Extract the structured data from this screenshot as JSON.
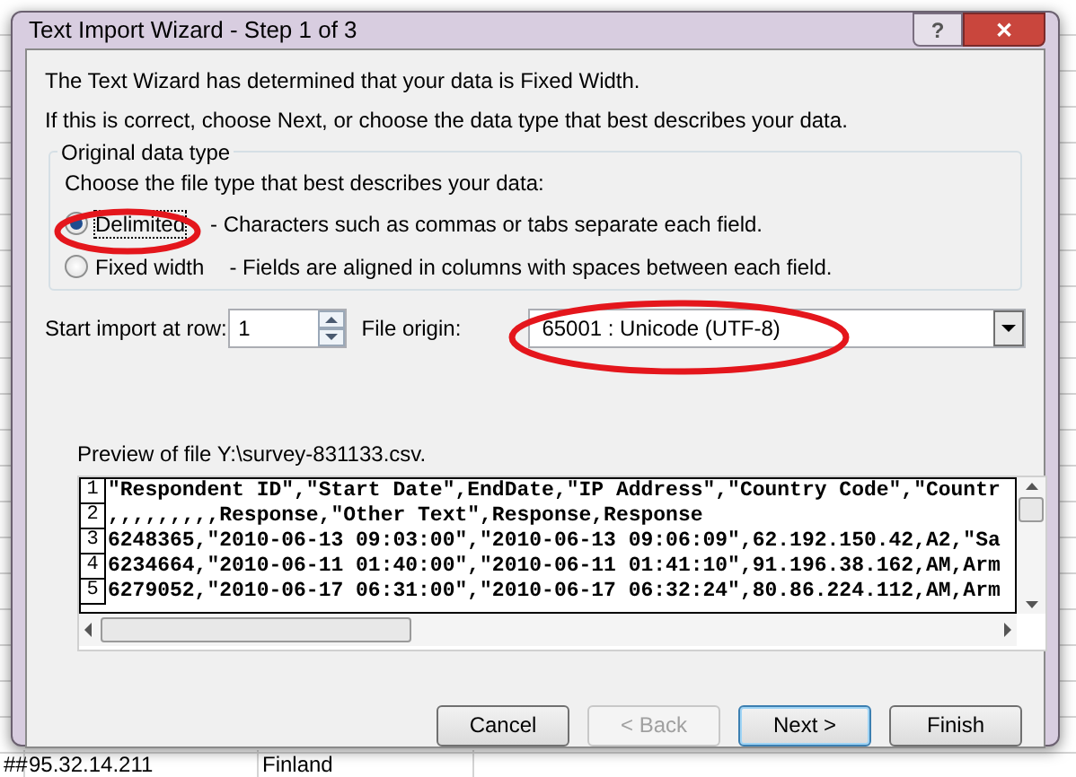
{
  "spreadsheet": {
    "bottom_row": [
      "##",
      "95.32.14.211",
      "Finland"
    ]
  },
  "window": {
    "title": "Text Import Wizard - Step 1 of 3",
    "help_button": "?",
    "close_button": "✕"
  },
  "intro": [
    "The Text Wizard has determined that your data is Fixed Width.",
    "If this is correct, choose Next, or choose the data type that best describes your data."
  ],
  "data_type_group": {
    "title": "Original data type",
    "prompt": "Choose the file type that best describes your data:",
    "options": [
      {
        "label": "Delimited",
        "description": "- Characters such as commas or tabs separate each field.",
        "selected": true
      },
      {
        "label": "Fixed width",
        "description": "- Fields are aligned in columns with spaces between each field.",
        "selected": false
      }
    ]
  },
  "start_row": {
    "label": "Start import at row:",
    "value": "1"
  },
  "file_origin": {
    "label": "File origin:",
    "value": "65001 : Unicode (UTF-8)"
  },
  "preview": {
    "label": "Preview of file Y:\\survey-831133.csv.",
    "lines": [
      {
        "number": "1",
        "text": "\"Respondent ID\",\"Start Date\",EndDate,\"IP Address\",\"Country Code\",\"Countr"
      },
      {
        "number": "2",
        "text": ",,,,,,,,,Response,\"Other Text\",Response,Response"
      },
      {
        "number": "3",
        "text": "6248365,\"2010-06-13 09:03:00\",\"2010-06-13 09:06:09\",62.192.150.42,A2,\"Sa"
      },
      {
        "number": "4",
        "text": "6234664,\"2010-06-11 01:40:00\",\"2010-06-11 01:41:10\",91.196.38.162,AM,Arm"
      },
      {
        "number": "5",
        "text": "6279052,\"2010-06-17 06:31:00\",\"2010-06-17 06:32:24\",80.86.224.112,AM,Arm"
      }
    ]
  },
  "buttons": [
    {
      "label": "Cancel",
      "disabled": false,
      "default": false
    },
    {
      "label": "< Back",
      "disabled": true,
      "default": false
    },
    {
      "label": "Next >",
      "disabled": false,
      "default": true
    },
    {
      "label": "Finish",
      "disabled": false,
      "default": false
    }
  ]
}
